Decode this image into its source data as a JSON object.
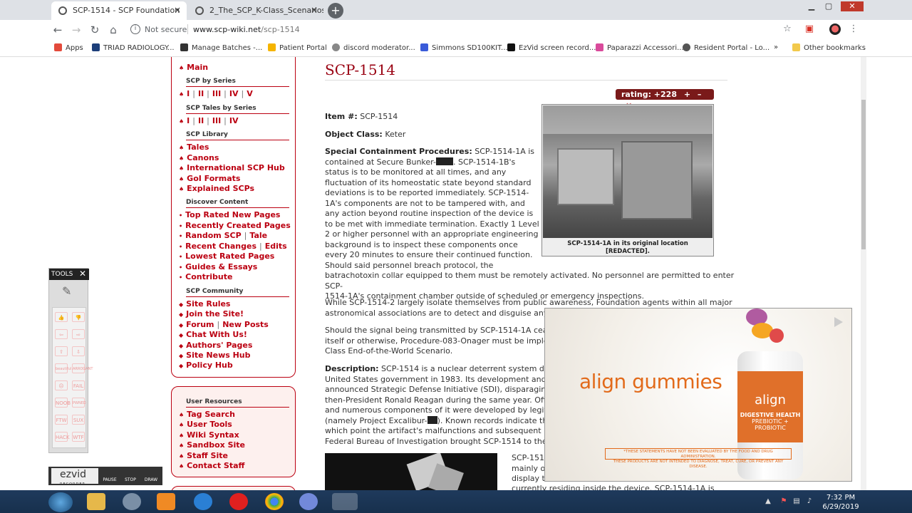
{
  "browser": {
    "tabs": [
      {
        "title": "SCP-1514 - SCP Foundation",
        "close": "×"
      },
      {
        "title": "2_The_SCP_K-Class_Scenarios_-_Y",
        "close": "×"
      }
    ],
    "new_tab": "+",
    "window_controls": [
      "▁",
      "▢",
      "✕"
    ],
    "security_label": "Not secure",
    "url_host": "www.scp-wiki.net",
    "url_path": "/scp-1514",
    "bookmarks": [
      {
        "label": "Apps",
        "color": "#e34a3b"
      },
      {
        "label": "TRIAD RADIOLOGY...",
        "color": "#1d3f7a"
      },
      {
        "label": "Manage Batches -...",
        "color": "#333333"
      },
      {
        "label": "Patient Portal",
        "color": "#f5b400"
      },
      {
        "label": "discord moderator...",
        "color": "#888888"
      },
      {
        "label": "Simmons SD100KIT...",
        "color": "#3a5bd9"
      },
      {
        "label": "EzVid screen record...",
        "color": "#111111"
      },
      {
        "label": "Paparazzi Accessori...",
        "color": "#d94a9b"
      },
      {
        "label": "Resident Portal - Lo...",
        "color": "#555555"
      }
    ],
    "more_bookmarks": "»",
    "other_bookmarks": "Other bookmarks"
  },
  "sidebar": {
    "main": "Main",
    "scp_by_series": {
      "heading": "SCP by Series",
      "items": [
        "I",
        "II",
        "III",
        "IV",
        "V"
      ]
    },
    "tales_by_series": {
      "heading": "SCP Tales by Series",
      "items": [
        "I",
        "II",
        "III",
        "IV"
      ]
    },
    "library": {
      "heading": "SCP Library",
      "items": [
        "Tales",
        "Canons",
        "International SCP Hub",
        "GoI Formats",
        "Explained SCPs"
      ]
    },
    "discover": {
      "heading": "Discover Content",
      "items": [
        "Top Rated New Pages",
        "Recently Created Pages",
        "Random SCP",
        "Tale",
        "Recent Changes",
        "Edits",
        "Lowest Rated Pages",
        "Guides & Essays",
        "Contribute"
      ]
    },
    "community": {
      "heading": "SCP Community",
      "items": [
        "Site Rules",
        "Join the Site!",
        "Forum",
        "New Posts",
        "Chat With Us!",
        "Authors' Pages",
        "Site News Hub",
        "Policy Hub"
      ]
    },
    "user_resources": {
      "heading": "User Resources",
      "items": [
        "Tag Search",
        "User Tools",
        "Wiki Syntax",
        "Sandbox Site",
        "Staff Site",
        "Contact Staff"
      ]
    }
  },
  "article": {
    "title": "SCP-1514",
    "rating_label": "rating: +228",
    "rating_plus": "+",
    "rating_minus": "–",
    "rating_x": "×",
    "item_label": "Item #:",
    "item_value": "SCP-1514",
    "class_label": "Object Class:",
    "class_value": "Keter",
    "scp_label": "Special Containment Procedures:",
    "scp_lines": [
      "SCP-1514-1A is",
      "contained at Secure Bunker-",
      ". SCP-1514-1B's",
      "status is to be monitored at all times, and any",
      "fluctuation of its homeostatic state beyond standard",
      "deviations is to be reported immediately. SCP-1514-",
      "1A's components are not to be tampered with, and",
      "any action beyond routine inspection of the device is",
      "to be met with immediate termination. Exactly 1 Level",
      "2 or higher personnel with an appropriate engineering",
      "background is to inspect these components once",
      "every 20 minutes to ensure their continued function.",
      "Should said personnel breach protocol, the",
      "batrachotoxin collar equipped to them must be remotely activated. No personnel are permitted to enter SCP-",
      "1514-1A's containment chamber outside of scheduled or emergency inspections."
    ],
    "para2_lines": [
      "While SCP-1514-2 largely isolate themselves from public awareness, Foundation agents within all major",
      "astronomical associations are to detect and disguise any ins"
    ],
    "para3_lines": [
      "Should the signal being transmitted by SCP-1514-1A cease,",
      "itself or otherwise, Procedure-083-Onager must be impleme",
      "Class End-of-the-World Scenario."
    ],
    "desc_label": "Description:",
    "desc_lines": [
      "SCP-1514 is a nuclear deterrent system deve",
      "United States government in 1983. Its development and de",
      "announced Strategic Defense Initiative (SDI), disparagingly",
      "then-President Ronald Reagan during the same year. Officia",
      "and numerous components of it were developed by legitima",
      "(namely Project Excalibur-",
      "). Known records indicate that",
      "which point the artifact's malfunctions and subsequent inves",
      "Federal Bureau of Investigation brought SCP-1514 to the Fo"
    ],
    "lower_lines": [
      "SCP-1514",
      "mainly of",
      "display th",
      "currently residing inside the device. SCP-1514-1A is"
    ],
    "image_caption_1": "SCP-1514-1A in its original location",
    "image_caption_2": "[REDACTED]."
  },
  "ad": {
    "brand": "align gummies",
    "jar_brand": "align",
    "jar_line1": "DIGESTIVE HEALTH",
    "jar_line2": "PREBIOTIC + PROBIOTIC",
    "disclaimer_1": "*THESE STATEMENTS HAVE NOT BEEN EVALUATED BY THE FOOD AND DRUG ADMINISTRATION.",
    "disclaimer_2": "THESE PRODUCTS ARE NOT INTENDED TO DIAGNOSE, TREAT, CURE, OR PREVENT ANY DISEASE."
  },
  "tools": {
    "title": "TOOLS",
    "close": "✕",
    "labels": [
      "FAIL",
      "NOOB",
      "PWNED",
      "FTW",
      "SUX",
      "HACK",
      "WTF"
    ],
    "thumb_labels": [
      "beautiful",
      "ARROGANT"
    ]
  },
  "ezvid": {
    "logo": "ezvid",
    "sub": "RECORDER",
    "buttons": [
      "PAUSE",
      "STOP",
      "DRAW"
    ]
  },
  "taskbar": {
    "time": "7:32 PM",
    "date": "6/29/2019"
  },
  "colors": {
    "accent": "#990000",
    "sidebar_link": "#bb0011",
    "ad_brand": "#e26a1a",
    "taskbar": "#1f3a5c"
  }
}
